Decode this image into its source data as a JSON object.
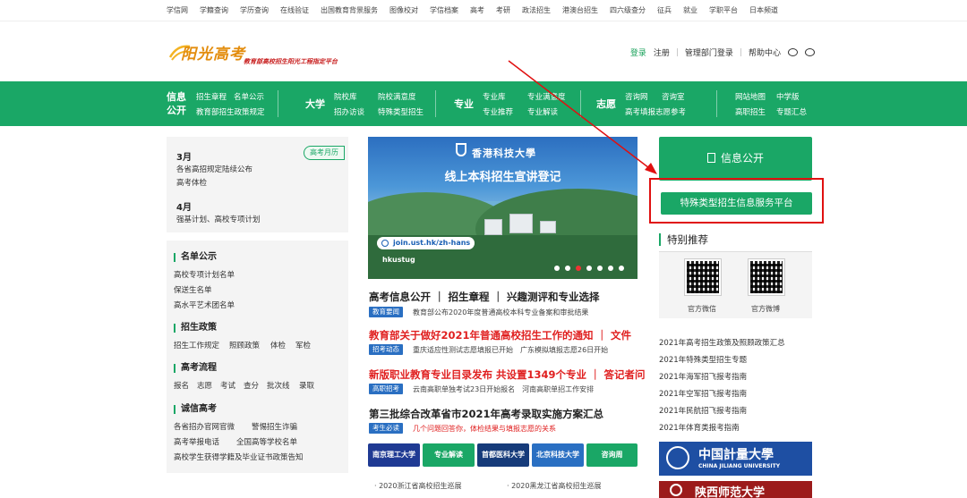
{
  "top_links": [
    "学信网",
    "学籍查询",
    "学历查询",
    "在线验证",
    "出国教育背景服务",
    "图像校对",
    "学信档案",
    "高考",
    "考研",
    "政法招生",
    "港澳台招生",
    "四六级查分",
    "征兵",
    "就业",
    "学职平台",
    "日本频道"
  ],
  "logo": {
    "name": "阳光高考",
    "slogan": "教育部高校招生阳光工程指定平台"
  },
  "header_links": {
    "login": "登录",
    "register": "注册",
    "admin": "管理部门登录",
    "help": "帮助中心"
  },
  "nav": {
    "info": {
      "head1": "信息",
      "head2": "公开",
      "l1": "招生章程",
      "l2": "名单公示",
      "l3": "教育部招生政策规定"
    },
    "daxue": {
      "head": "大学",
      "l1": "院校库",
      "l2": "院校满意度",
      "l3": "招办访谈",
      "l4": "特殊类型招生"
    },
    "zhuanye": {
      "head": "专业",
      "l1": "专业库",
      "l2": "专业满意度",
      "l3": "专业推荐",
      "l4": "专业解读"
    },
    "zhiyuan": {
      "head": "志愿",
      "l1": "咨询网",
      "l2": "咨询室",
      "l3": "高考填报志愿参考"
    },
    "other": {
      "l1": "网站地图",
      "l2": "中学版",
      "l3": "高职招生",
      "l4": "专题汇总"
    }
  },
  "calendar": {
    "tag": "高考月历",
    "m1": "3月",
    "m1_i1": "各省高招规定陆续公布",
    "m1_i2": "高考体检",
    "m2": "4月",
    "m2_i1": "强基计划、高校专项计划"
  },
  "left_sections": {
    "s1_title": "名单公示",
    "s1_l1": "高校专项计划名单",
    "s1_l2": "保送生名单",
    "s1_l3": "高水平艺术团名单",
    "s2_title": "招生政策",
    "s2_l1": "招生工作规定",
    "s2_l2": "照顾政策",
    "s2_l3": "体检",
    "s2_l4": "军检",
    "s3_title": "高考流程",
    "s3_items": [
      "报名",
      "志愿",
      "考试",
      "查分",
      "批次线",
      "录取"
    ],
    "s4_title": "诚信高考",
    "s4_l1": "各省招办官网官微",
    "s4_l2": "警惕招生诈骗",
    "s4_l3": "高考举报电话",
    "s4_l4": "全国高等学校名单",
    "s4_l5": "高校学生获得学籍及毕业证书政策告知"
  },
  "banner": {
    "university": "香港科技大學",
    "headline": "线上本科招生宣讲登记",
    "url": "join.ust.hk/zh-hans",
    "handle": "hkustug"
  },
  "news": {
    "h1": "高考信息公开 ｜ 招生章程 ｜ 兴趣测评和专业选择",
    "b1": "教育要闻",
    "s1": "教育部公布2020年度普通高校本科专业备案和审批结果",
    "h2": "教育部关于做好2021年普通高校招生工作的通知 ｜ 文件",
    "b2": "招考动态",
    "s2": "重庆适应性测试志愿填报已开始　广东模拟填报志愿26日开始",
    "h3": "新版职业教育专业目录发布 共设置1349个专业 ｜ 答记者问",
    "b3": "高职招考",
    "s3": "云南高职单独考试23日开始报名　河南高职单招工作安排",
    "h4": "第三批综合改革省市2021年高考录取实施方案汇总",
    "b4": "考生必读",
    "s4": "几个问题回答你，体检结果与填报志愿的关系"
  },
  "logo_strip": [
    "南京理工大学",
    "专业解读",
    "首都医科大学",
    "北京科技大学",
    "咨询周"
  ],
  "bottom_items": [
    "2020浙江省高校招生巡展",
    "2020黑龙江省高校招生巡展"
  ],
  "right": {
    "info_button": "信息公开",
    "special_button": "特殊类型招生信息服务平台",
    "rec_title": "特别推荐",
    "qr1": "官方微信",
    "qr2": "官方微博",
    "guides": [
      "2021年高考招生政策及照顾政策汇总",
      "2021年特殊类型招生专题",
      "2021年海军招飞报考指南",
      "2021年空军招飞报考指南",
      "2021年民航招飞报考指南",
      "2021年体育类报考指南"
    ],
    "ad1": "中国計量大學",
    "ad1_sub": "CHINA JILIANG UNIVERSITY",
    "ad2": "陕西师范大学"
  },
  "colors": {
    "brand_green": "#1aa766",
    "alert_red": "#e01010",
    "link_blue": "#2a6fc2"
  }
}
